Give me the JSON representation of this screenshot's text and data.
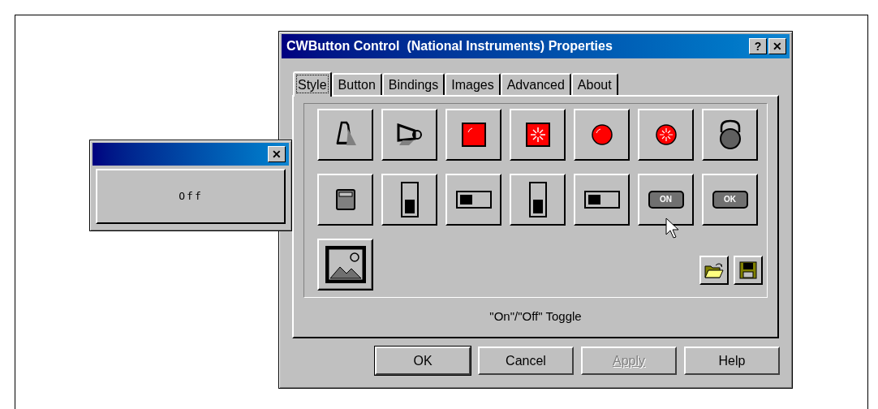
{
  "dialog": {
    "title": "CWButton Control  (National Instruments) Properties",
    "title_buttons": [
      "?",
      "✕"
    ],
    "tabs": [
      {
        "label": "Style",
        "selected": true
      },
      {
        "label": "Button",
        "selected": false
      },
      {
        "label": "Bindings",
        "selected": false
      },
      {
        "label": "Images",
        "selected": false
      },
      {
        "label": "Advanced",
        "selected": false
      },
      {
        "label": "About",
        "selected": false
      }
    ],
    "styles": [
      {
        "kind": "bell"
      },
      {
        "kind": "horn"
      },
      {
        "kind": "square-led"
      },
      {
        "kind": "square-burst"
      },
      {
        "kind": "round-led"
      },
      {
        "kind": "round-burst"
      },
      {
        "kind": "lever"
      },
      {
        "kind": "toggle-box"
      },
      {
        "kind": "vslider"
      },
      {
        "kind": "hslider"
      },
      {
        "kind": "vslider"
      },
      {
        "kind": "hslider"
      },
      {
        "kind": "label-button",
        "label": "ON"
      },
      {
        "kind": "label-button",
        "label": "OK"
      },
      {
        "kind": "picture-frame"
      }
    ],
    "description": "\"On\"/\"Off\" Toggle",
    "buttons": [
      {
        "label": "OK",
        "disabled": false,
        "default": true
      },
      {
        "label": "Cancel",
        "disabled": false,
        "default": false
      },
      {
        "label": "Apply",
        "disabled": true,
        "default": false
      },
      {
        "label": "Help",
        "disabled": false,
        "default": false
      }
    ]
  },
  "preview": {
    "close": "✕",
    "button": "Off"
  }
}
